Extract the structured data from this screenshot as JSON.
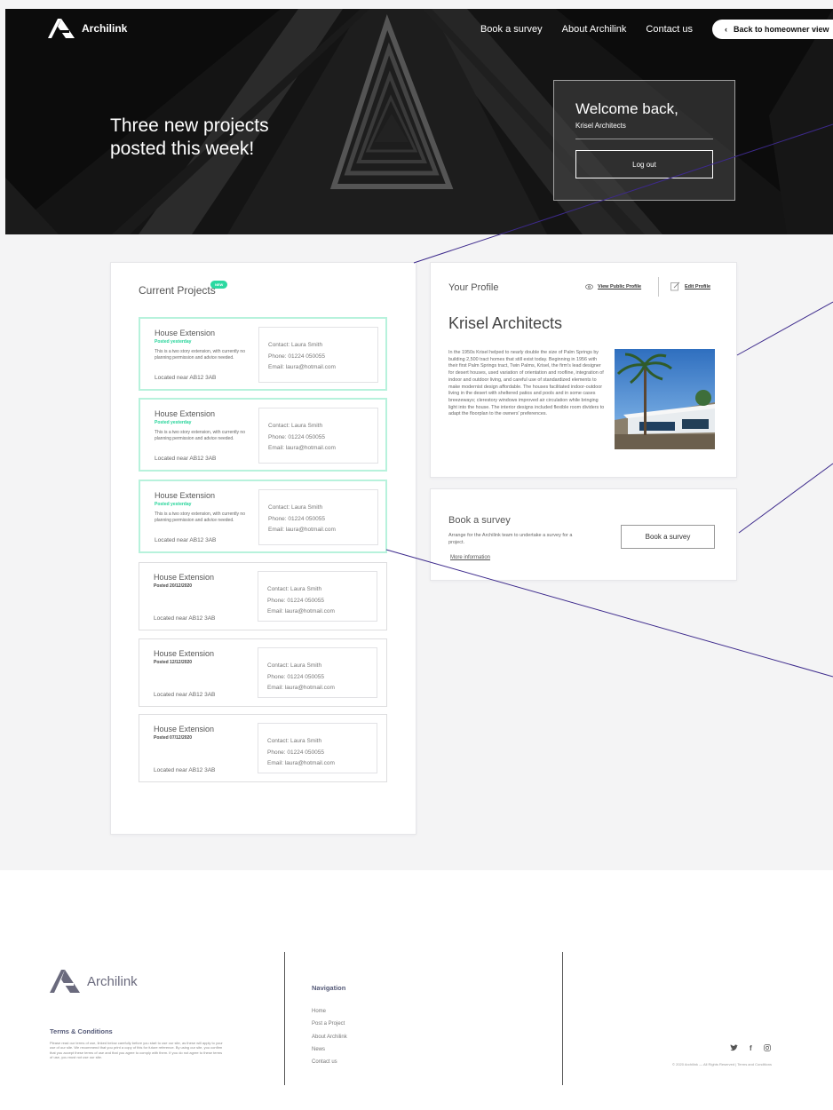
{
  "header": {
    "brand": "Archilink",
    "nav": [
      "Book a survey",
      "About Archilink",
      "Contact us"
    ],
    "back_label": "Back to homeowner view"
  },
  "hero": {
    "title": "Three new projects posted this week!",
    "welcome": "Welcome back,",
    "user": "Krisel Architects",
    "logout": "Log out"
  },
  "projects": {
    "title": "Current Projects",
    "badge": "NEW",
    "items": [
      {
        "title": "House Extension",
        "posted": "Posted yesterday",
        "desc": "This is a two story extension, with currently no planning permission and advice needed.",
        "location": "Located near AB12 3AB",
        "contact": "Contact: Laura Smith",
        "phone": "Phone: 01224 050055",
        "email": "Email: laura@hotmail.com"
      },
      {
        "title": "House Extension",
        "posted": "Posted yesterday",
        "desc": "This is a two story extension, with currently no planning permission and advice needed.",
        "location": "Located near AB12 3AB",
        "contact": "Contact: Laura Smith",
        "phone": "Phone: 01224 050055",
        "email": "Email: laura@hotmail.com"
      },
      {
        "title": "House Extension",
        "posted": "Posted yesterday",
        "desc": "This is a two story extension, with currently no planning permission and advice needed.",
        "location": "Located near AB12 3AB",
        "contact": "Contact: Laura Smith",
        "phone": "Phone: 01224 050055",
        "email": "Email: laura@hotmail.com"
      },
      {
        "title": "House Extension",
        "posted": "Posted 20/12/2020",
        "desc": "",
        "location": "Located near AB12 3AB",
        "contact": "Contact: Laura Smith",
        "phone": "Phone: 01224 050055",
        "email": "Email: laura@hotmail.com"
      },
      {
        "title": "House Extension",
        "posted": "Posted 12/12/2020",
        "desc": "",
        "location": "Located near AB12 3AB",
        "contact": "Contact: Laura Smith",
        "phone": "Phone: 01224 050055",
        "email": "Email: laura@hotmail.com"
      },
      {
        "title": "House Extension",
        "posted": "Posted 07/12/2020",
        "desc": "",
        "location": "Located near AB12 3AB",
        "contact": "Contact: Laura Smith",
        "phone": "Phone: 01224 050055",
        "email": "Email: laura@hotmail.com"
      }
    ]
  },
  "profile": {
    "title": "Your Profile",
    "view_public": "View Public Profile",
    "edit": "Edit Profile",
    "name": "Krisel Architects",
    "bio": "In the 1950s Krisel helped to nearly double the size of Palm Springs by building 2,500 tract homes that still exist today. Beginning in 1956 with their first Palm Springs tract, Twin Palms, Krisel, the firm's lead designer for desert houses, used variation of orientation and roofline, integration of indoor and outdoor living, and careful use of standardized elements to make modernist design affordable. The houses facilitated indoor-outdoor living in the desert with sheltered patios and pools and in some cases breezeways; clerestory windows improved air circulation while bringing light into the house. The interior designs included flexible room dividers to adapt the floorplan to the owners' preferences."
  },
  "survey": {
    "title": "Book a survey",
    "desc": "Arrange for the Archilink team to undertake a survey for a project.",
    "more": "More information",
    "button": "Book a survey"
  },
  "footer": {
    "brand": "Archilink",
    "terms_title": "Terms & Conditions",
    "terms_text": "Please read our terms of use, linked below carefully before you start to use our site, as these will apply to your use of our site. We recommend that you print a copy of this for future reference. By using our site, you confirm that you accept these terms of use and that you agree to comply with them. If you do not agree to these terms of use, you must not use our site.",
    "nav_title": "Navigation",
    "nav_links": [
      "Home",
      "Post a Project",
      "About Archilink",
      "News",
      "Contact us"
    ],
    "copyright": "© 2020 Archilink — All Rights Reserved | Terms and Conditions"
  }
}
